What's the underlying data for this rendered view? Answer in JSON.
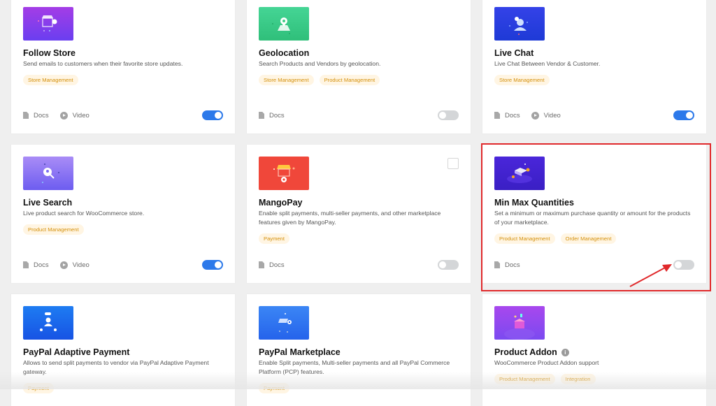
{
  "labels": {
    "docs": "Docs",
    "video": "Video"
  },
  "colors": {
    "toggle_on": "#2c79ea",
    "toggle_off": "#d4d6d8",
    "tag_text": "#d4900b",
    "tag_bg": "#fff5e3",
    "highlight": "#e0292b"
  },
  "modules": [
    {
      "title": "Follow Store",
      "description": "Send emails to customers when their favorite store updates.",
      "tags": [
        "Store Management"
      ],
      "has_docs": true,
      "has_video": true,
      "enabled": true,
      "icon": "store-follow-icon",
      "thumb_color": "#7b3fe4"
    },
    {
      "title": "Geolocation",
      "description": "Search Products and Vendors by geolocation.",
      "tags": [
        "Store Management",
        "Product Management"
      ],
      "has_docs": true,
      "has_video": false,
      "enabled": false,
      "icon": "map-pin-icon",
      "thumb_color": "#3ecf8e"
    },
    {
      "title": "Live Chat",
      "description": "Live Chat Between Vendor & Customer.",
      "tags": [
        "Store Management"
      ],
      "has_docs": true,
      "has_video": true,
      "enabled": true,
      "icon": "chat-icon",
      "thumb_color": "#2b44e0"
    },
    {
      "title": "Live Search",
      "description": "Live product search for WooCommerce store.",
      "tags": [
        "Product Management"
      ],
      "has_docs": true,
      "has_video": true,
      "enabled": true,
      "icon": "search-icon",
      "thumb_color": "#8d6bf2"
    },
    {
      "title": "MangoPay",
      "description": "Enable split payments, multi-seller payments, and other marketplace features given by MangoPay.",
      "tags": [
        "Payment"
      ],
      "has_docs": true,
      "has_video": false,
      "enabled": false,
      "icon": "store-coin-icon",
      "thumb_color": "#f04a3a",
      "has_checkbox": true
    },
    {
      "title": "Min Max Quantities",
      "description": "Set a minimum or maximum purchase quantity or amount for the products of your marketplace.",
      "tags": [
        "Product Management",
        "Order Management"
      ],
      "has_docs": true,
      "has_video": false,
      "enabled": false,
      "icon": "coins-stack-icon",
      "thumb_color": "#4a25d6",
      "highlighted": true
    },
    {
      "title": "PayPal Adaptive Payment",
      "description": "Allows to send split payments to vendor via PayPal Adaptive Payment gateway.",
      "tags": [
        "Payment"
      ],
      "icon": "user-network-icon",
      "thumb_color": "#1d6cf0"
    },
    {
      "title": "PayPal Marketplace",
      "description": "Enable Split payments, Multi-seller payments and all PayPal Commerce Platform (PCP) features.",
      "tags": [
        "Payment"
      ],
      "icon": "store-front-icon",
      "thumb_color": "#2f7af5"
    },
    {
      "title": "Product Addon",
      "description": "WooCommerce Product Addon support",
      "tags": [
        "Product Management",
        "Integration"
      ],
      "icon": "gift-box-icon",
      "thumb_color": "#9a4cf0",
      "has_info": true
    }
  ]
}
